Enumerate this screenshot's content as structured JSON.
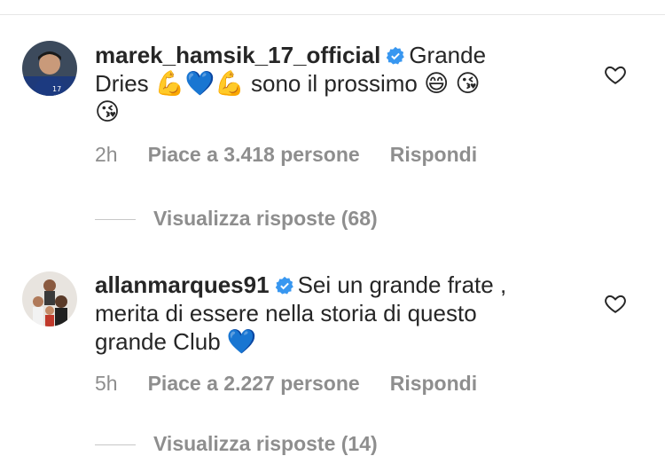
{
  "comments": [
    {
      "username": "marek_hamsik_17_official",
      "verified": true,
      "text_line1": "Grande",
      "text_line2_a": "Dries",
      "text_line2_b": "sono il prossimo",
      "emojis_a": [
        "flexed-biceps",
        "blue-heart",
        "flexed-biceps"
      ],
      "emojis_b": [
        "grinning-face",
        "face-blowing-kiss"
      ],
      "emojis_c": [
        "face-blowing-kiss"
      ],
      "time": "2h",
      "likes": "Piace a 3.418 persone",
      "reply": "Rispondi",
      "view_replies": "Visualizza risposte (68)"
    },
    {
      "username": "allanmarques91",
      "verified": true,
      "text_line1": "Sei un grande frate ,",
      "text_line2": "merita di essere nella storia di questo",
      "text_line3": "grande Club",
      "emojis_a": [
        "blue-heart"
      ],
      "time": "5h",
      "likes": "Piace a 2.227 persone",
      "reply": "Rispondi",
      "view_replies": "Visualizza risposte (14)"
    }
  ],
  "colors": {
    "text": "#262626",
    "meta": "#8e8e8e",
    "verified_blue": "#3897f0",
    "heart_outline": "#262626"
  }
}
